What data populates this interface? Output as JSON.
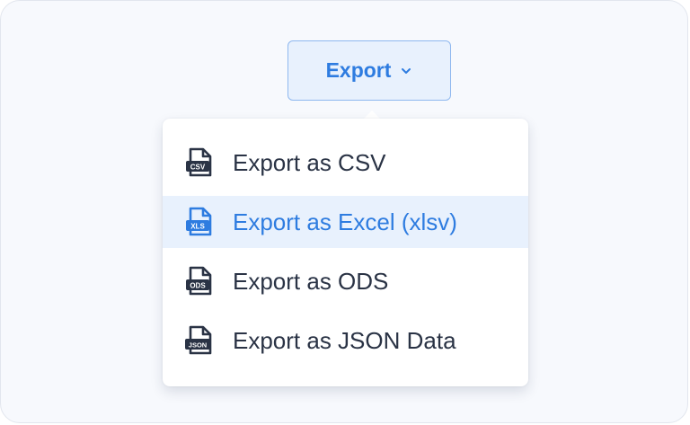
{
  "export_button": {
    "label": "Export",
    "icon": "chevron-down-icon"
  },
  "menu": {
    "items": [
      {
        "label": "Export as CSV",
        "icon": "csv-file-icon",
        "badge": "CSV",
        "active": false
      },
      {
        "label": "Export as Excel (xlsv)",
        "icon": "xls-file-icon",
        "badge": "XLS",
        "active": true
      },
      {
        "label": "Export as ODS",
        "icon": "ods-file-icon",
        "badge": "ODS",
        "active": false
      },
      {
        "label": "Export as JSON Data",
        "icon": "json-file-icon",
        "badge": "JSON",
        "active": false
      }
    ]
  },
  "colors": {
    "accent": "#2e7ce0",
    "accent_bg": "#e8f1fd",
    "text": "#2a3345"
  }
}
